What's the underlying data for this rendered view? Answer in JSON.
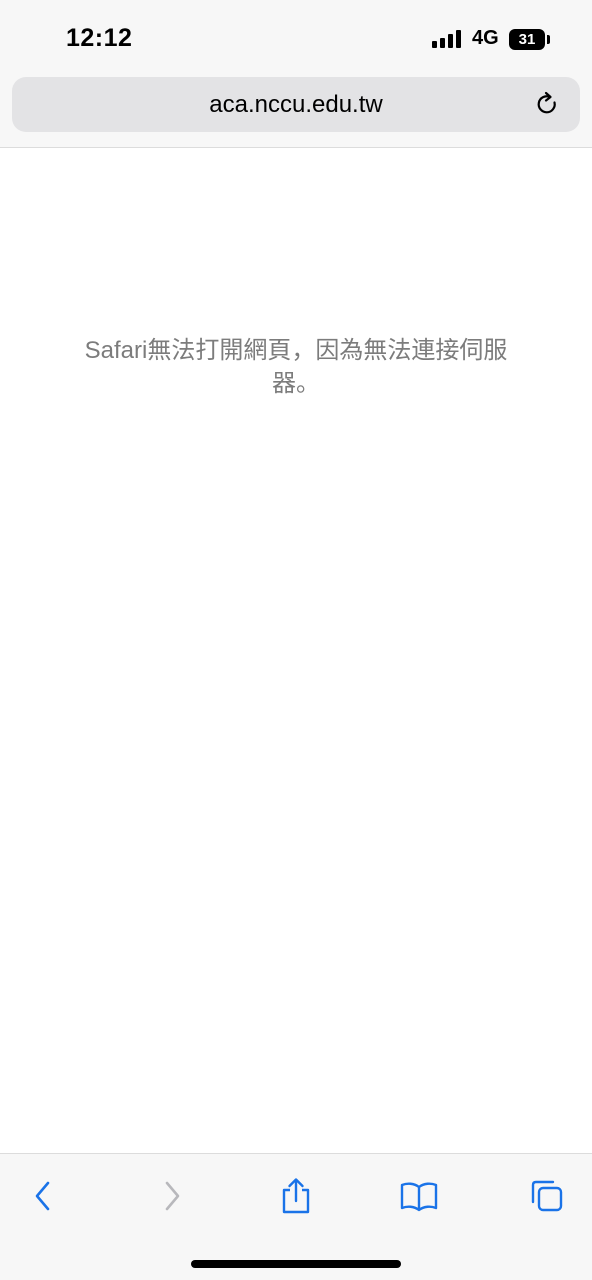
{
  "status_bar": {
    "time": "12:12",
    "network": "4G",
    "battery_level": "31",
    "signal_icon": "cellular-signal-icon"
  },
  "address_bar": {
    "url": "aca.nccu.edu.tw",
    "reload_icon": "reload-icon"
  },
  "page": {
    "error_message": "Safari無法打開網頁，因為無法連接伺服器。"
  },
  "toolbar": {
    "items": [
      {
        "icon": "back-chevron-icon",
        "enabled": true
      },
      {
        "icon": "forward-chevron-icon",
        "enabled": false
      },
      {
        "icon": "share-icon",
        "enabled": true
      },
      {
        "icon": "bookmarks-book-icon",
        "enabled": true
      },
      {
        "icon": "tabs-icon",
        "enabled": true
      }
    ]
  },
  "colors": {
    "accent": "#1a73e8",
    "disabled": "#b8b8bc",
    "chrome_background": "#f7f7f7",
    "url_field_background": "#e3e3e5",
    "error_text": "#7c7c7c"
  }
}
